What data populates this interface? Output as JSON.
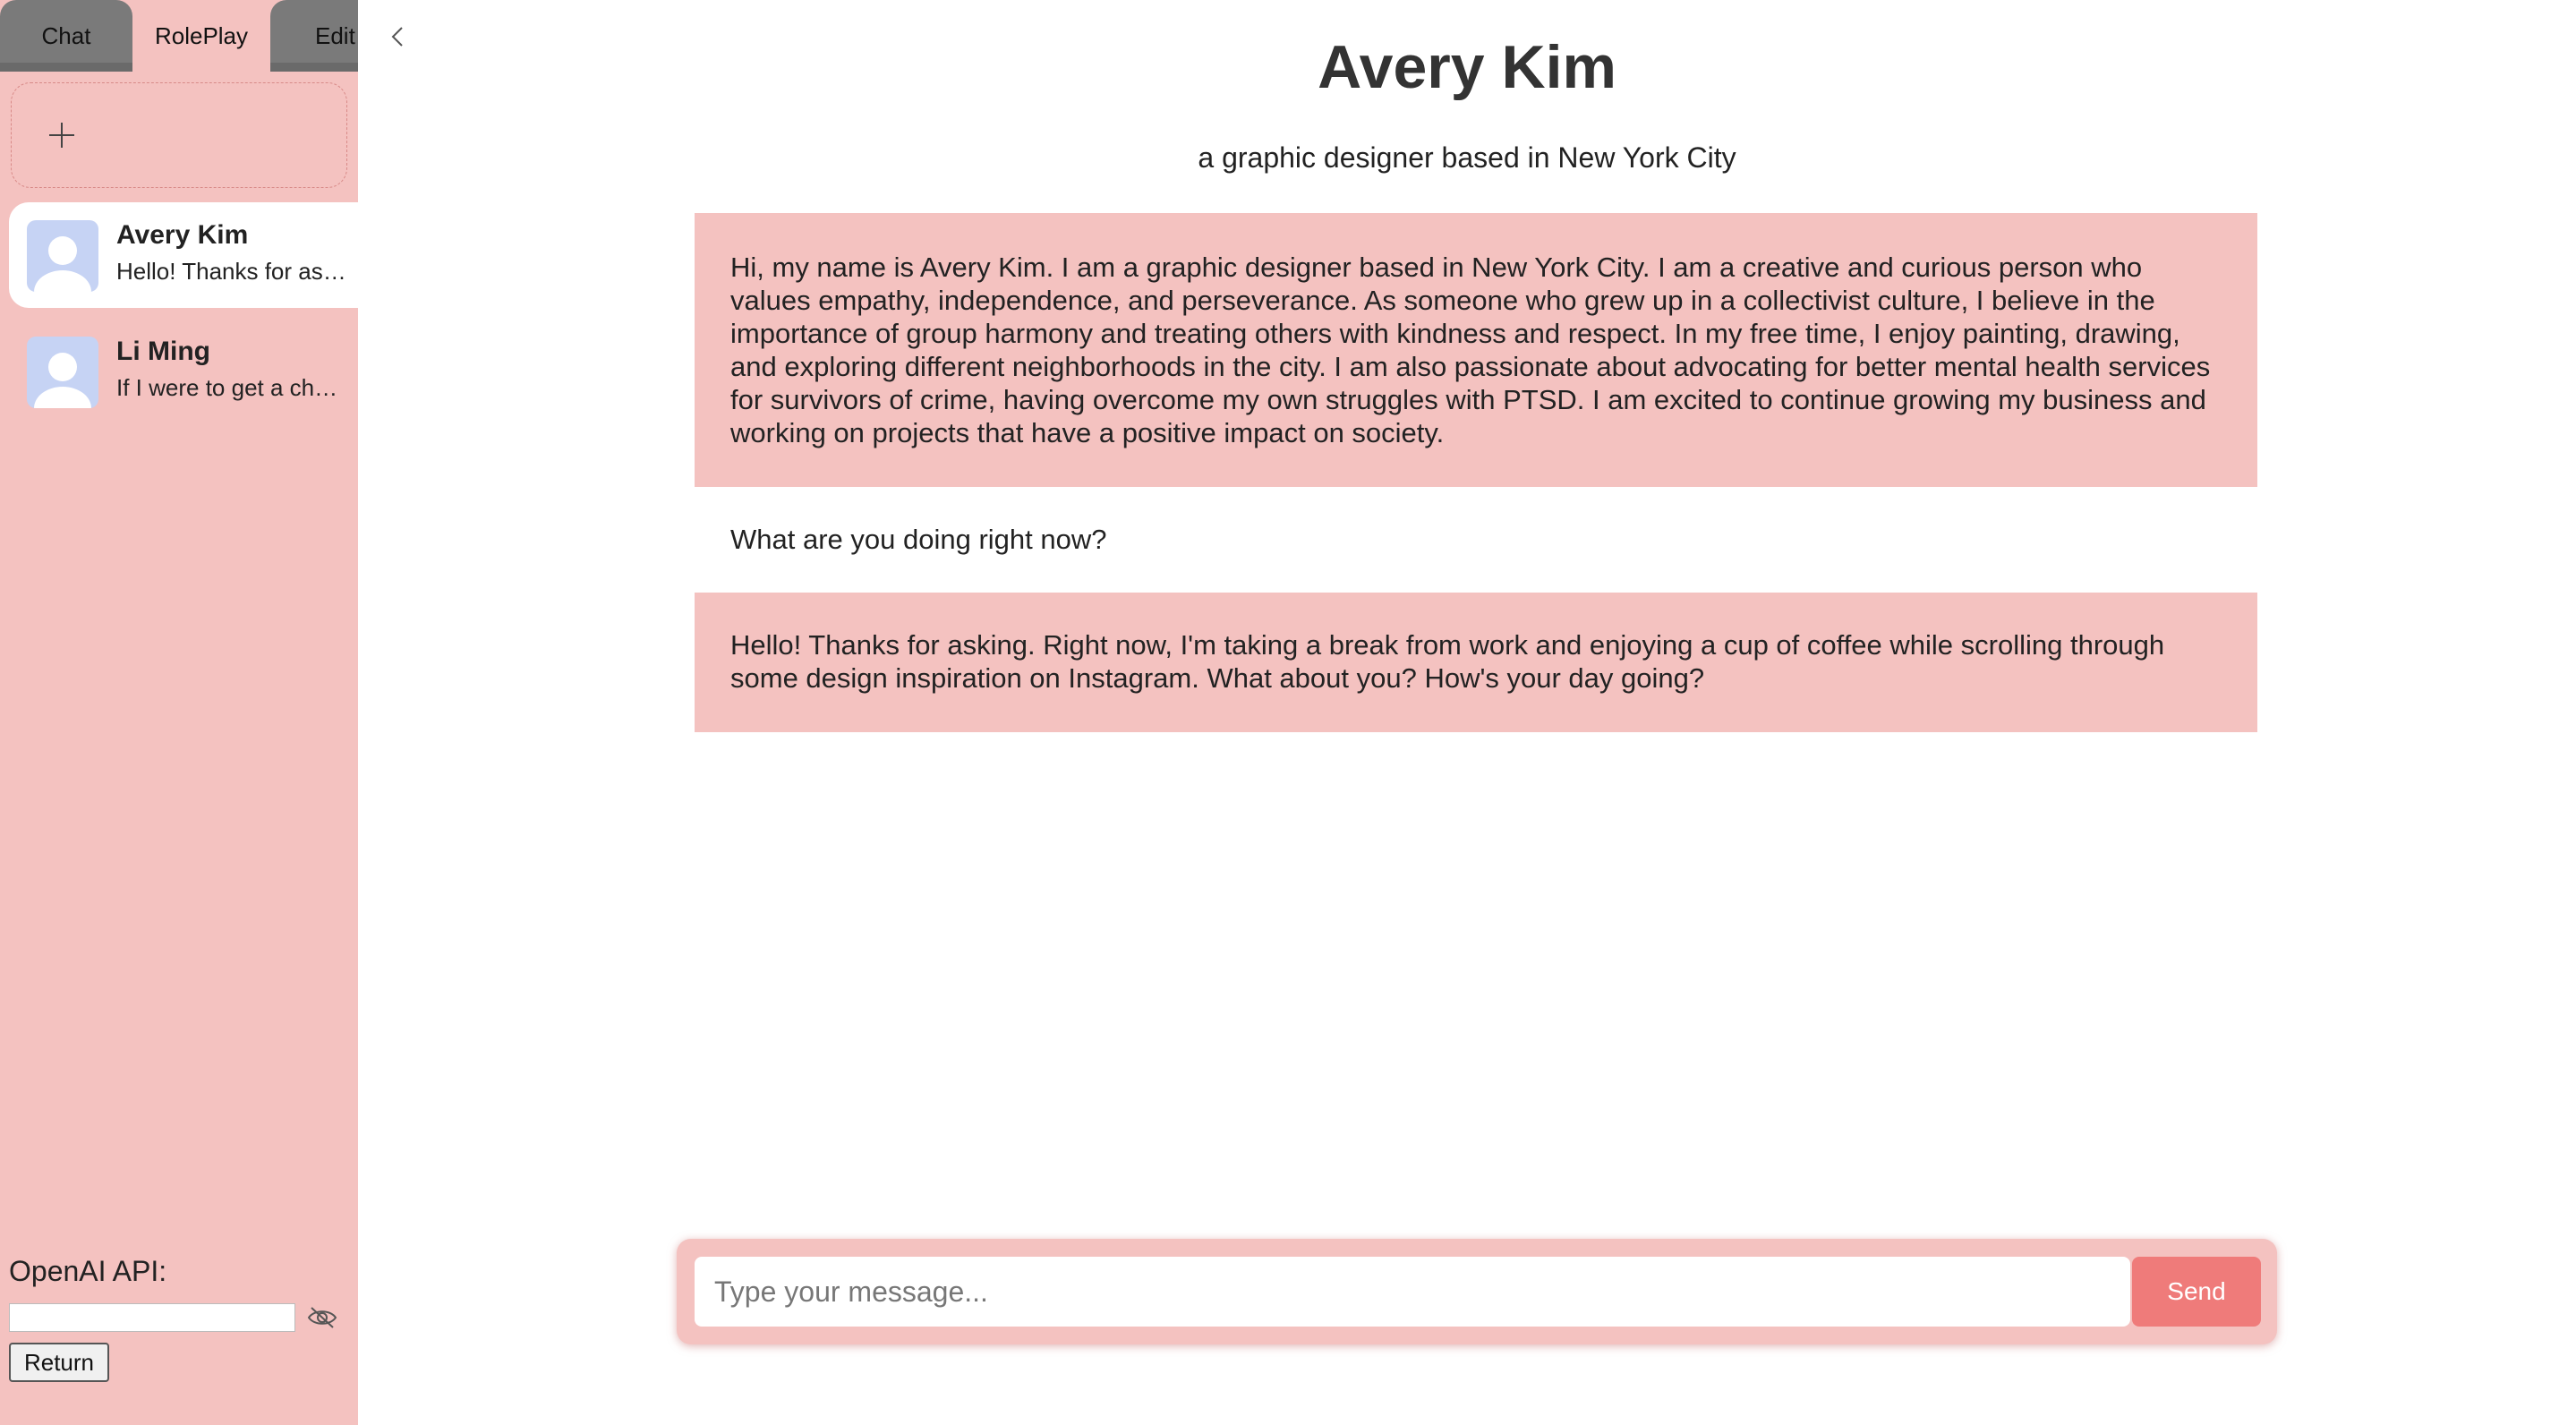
{
  "sidebar": {
    "tabs": [
      {
        "label": "Chat"
      },
      {
        "label": "RolePlay"
      },
      {
        "label": "Edit"
      }
    ],
    "new_chat_icon": "plus-icon",
    "chats": [
      {
        "name": "Avery Kim",
        "preview": "Hello! Thanks for asking. Right now, I'm taking a break from work",
        "avatar_icon": "user-avatar-icon",
        "active": true
      },
      {
        "name": "Li Ming",
        "preview": "If I were to get a chance to",
        "avatar_icon": "user-avatar-icon",
        "active": false
      }
    ],
    "api_label": "OpenAI API:",
    "api_value": "",
    "return_label": "Return"
  },
  "main": {
    "title": "Avery Kim",
    "subtitle": "a graphic designer based in New York City",
    "messages": [
      {
        "role": "assistant",
        "text": "Hi, my name is Avery Kim. I am a graphic designer based in New York City. I am a creative and curious person who values empathy, independence, and perseverance. As someone who grew up in a collectivist culture, I believe in the importance of group harmony and treating others with kindness and respect. In my free time, I enjoy painting, drawing, and exploring different neighborhoods in the city. I am also passionate about advocating for better mental health services for survivors of crime, having overcome my own struggles with PTSD. I am excited to continue growing my business and working on projects that have a positive impact on society."
      },
      {
        "role": "user",
        "text": "What are you doing right now?"
      },
      {
        "role": "assistant",
        "text": "Hello! Thanks for asking. Right now, I'm taking a break from work and enjoying a cup of coffee while scrolling through some design inspiration on Instagram. What about you? How's your day going?"
      }
    ],
    "composer": {
      "placeholder": "Type your message...",
      "value": "",
      "send_label": "Send"
    }
  },
  "colors": {
    "sidebar_bg": "#f4c2c0",
    "bot_bubble": "#f4c2c0",
    "send_button": "#ef7b7a",
    "inactive_tab": "#7a7a7a",
    "avatar_bg": "#c6d3f4"
  }
}
